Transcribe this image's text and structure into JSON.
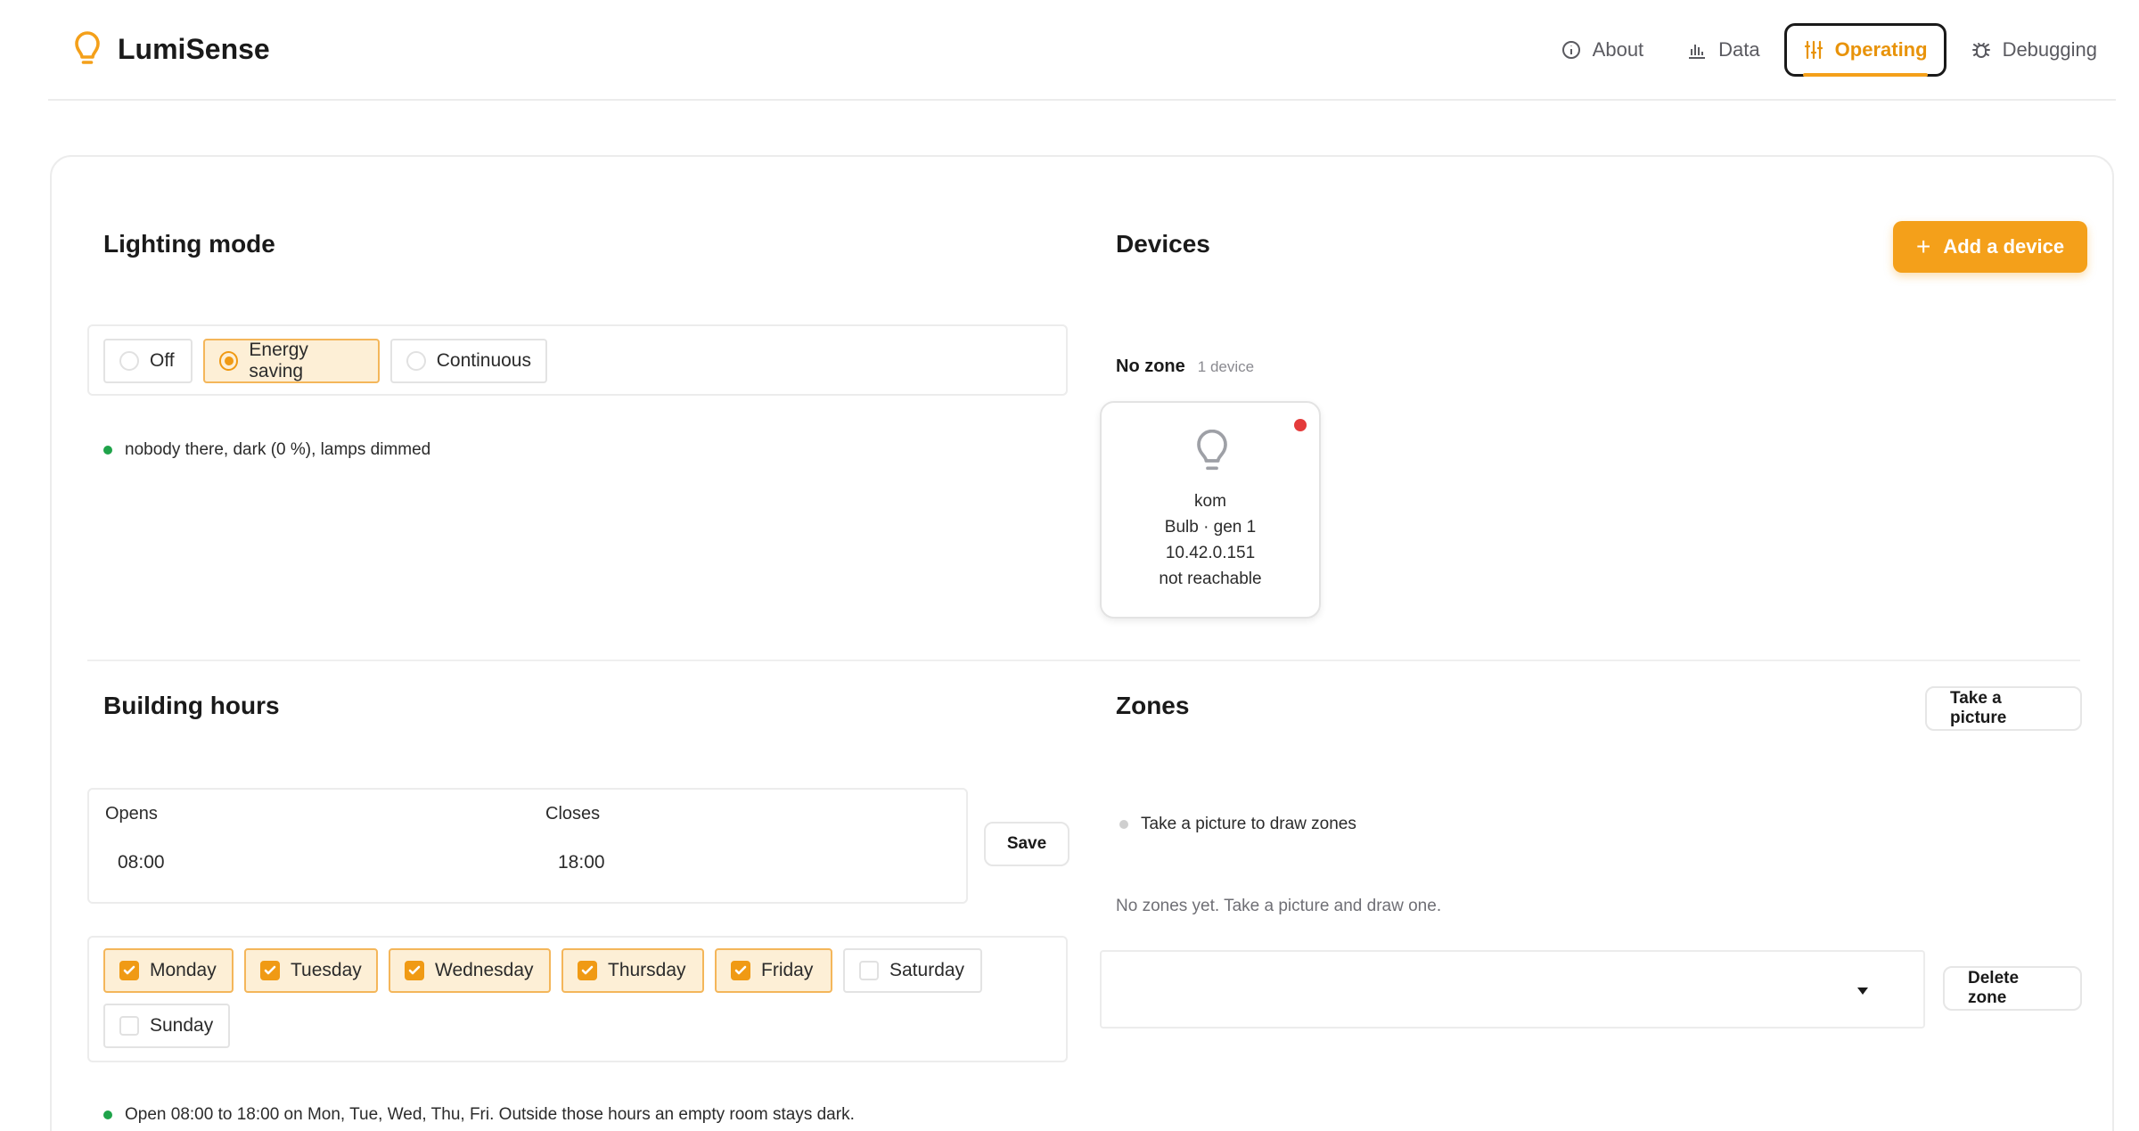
{
  "app": {
    "name": "LumiSense"
  },
  "nav": [
    {
      "label": "About",
      "icon": "info-icon",
      "active": false
    },
    {
      "label": "Data",
      "icon": "bar-chart-icon",
      "active": false
    },
    {
      "label": "Operating",
      "icon": "sliders-icon",
      "active": true
    },
    {
      "label": "Debugging",
      "icon": "bug-icon",
      "active": false
    }
  ],
  "lighting": {
    "title": "Lighting mode",
    "options": [
      {
        "label": "Off",
        "selected": false
      },
      {
        "label": "Energy saving",
        "selected": true
      },
      {
        "label": "Continuous",
        "selected": false
      }
    ],
    "status": "nobody there, dark (0 %), lamps dimmed"
  },
  "devices": {
    "title": "Devices",
    "add_label": "Add a device",
    "group_name": "No zone",
    "group_count": "1 device",
    "device": {
      "name": "kom",
      "type": "Bulb · gen 1",
      "ip": "10.42.0.151",
      "state": "not reachable",
      "status_color": "#e43b3b"
    }
  },
  "hours": {
    "title": "Building hours",
    "opens_label": "Opens",
    "opens_value": "08:00",
    "closes_label": "Closes",
    "closes_value": "18:00",
    "save_label": "Save",
    "days": [
      {
        "label": "Monday",
        "checked": true
      },
      {
        "label": "Tuesday",
        "checked": true
      },
      {
        "label": "Wednesday",
        "checked": true
      },
      {
        "label": "Thursday",
        "checked": true
      },
      {
        "label": "Friday",
        "checked": true
      },
      {
        "label": "Saturday",
        "checked": false
      },
      {
        "label": "Sunday",
        "checked": false
      }
    ],
    "status": "Open 08:00 to 18:00 on Mon, Tue, Wed, Thu, Fri. Outside those hours an empty room stays dark."
  },
  "zones": {
    "title": "Zones",
    "take_picture_label": "Take a picture",
    "status": "Take a picture to draw zones",
    "empty_message": "No zones yet. Take a picture and draw one.",
    "select_value": "",
    "delete_label": "Delete zone"
  },
  "colors": {
    "accent": "#f4a01a",
    "ok": "#1fa34a",
    "error": "#e43b3b"
  }
}
